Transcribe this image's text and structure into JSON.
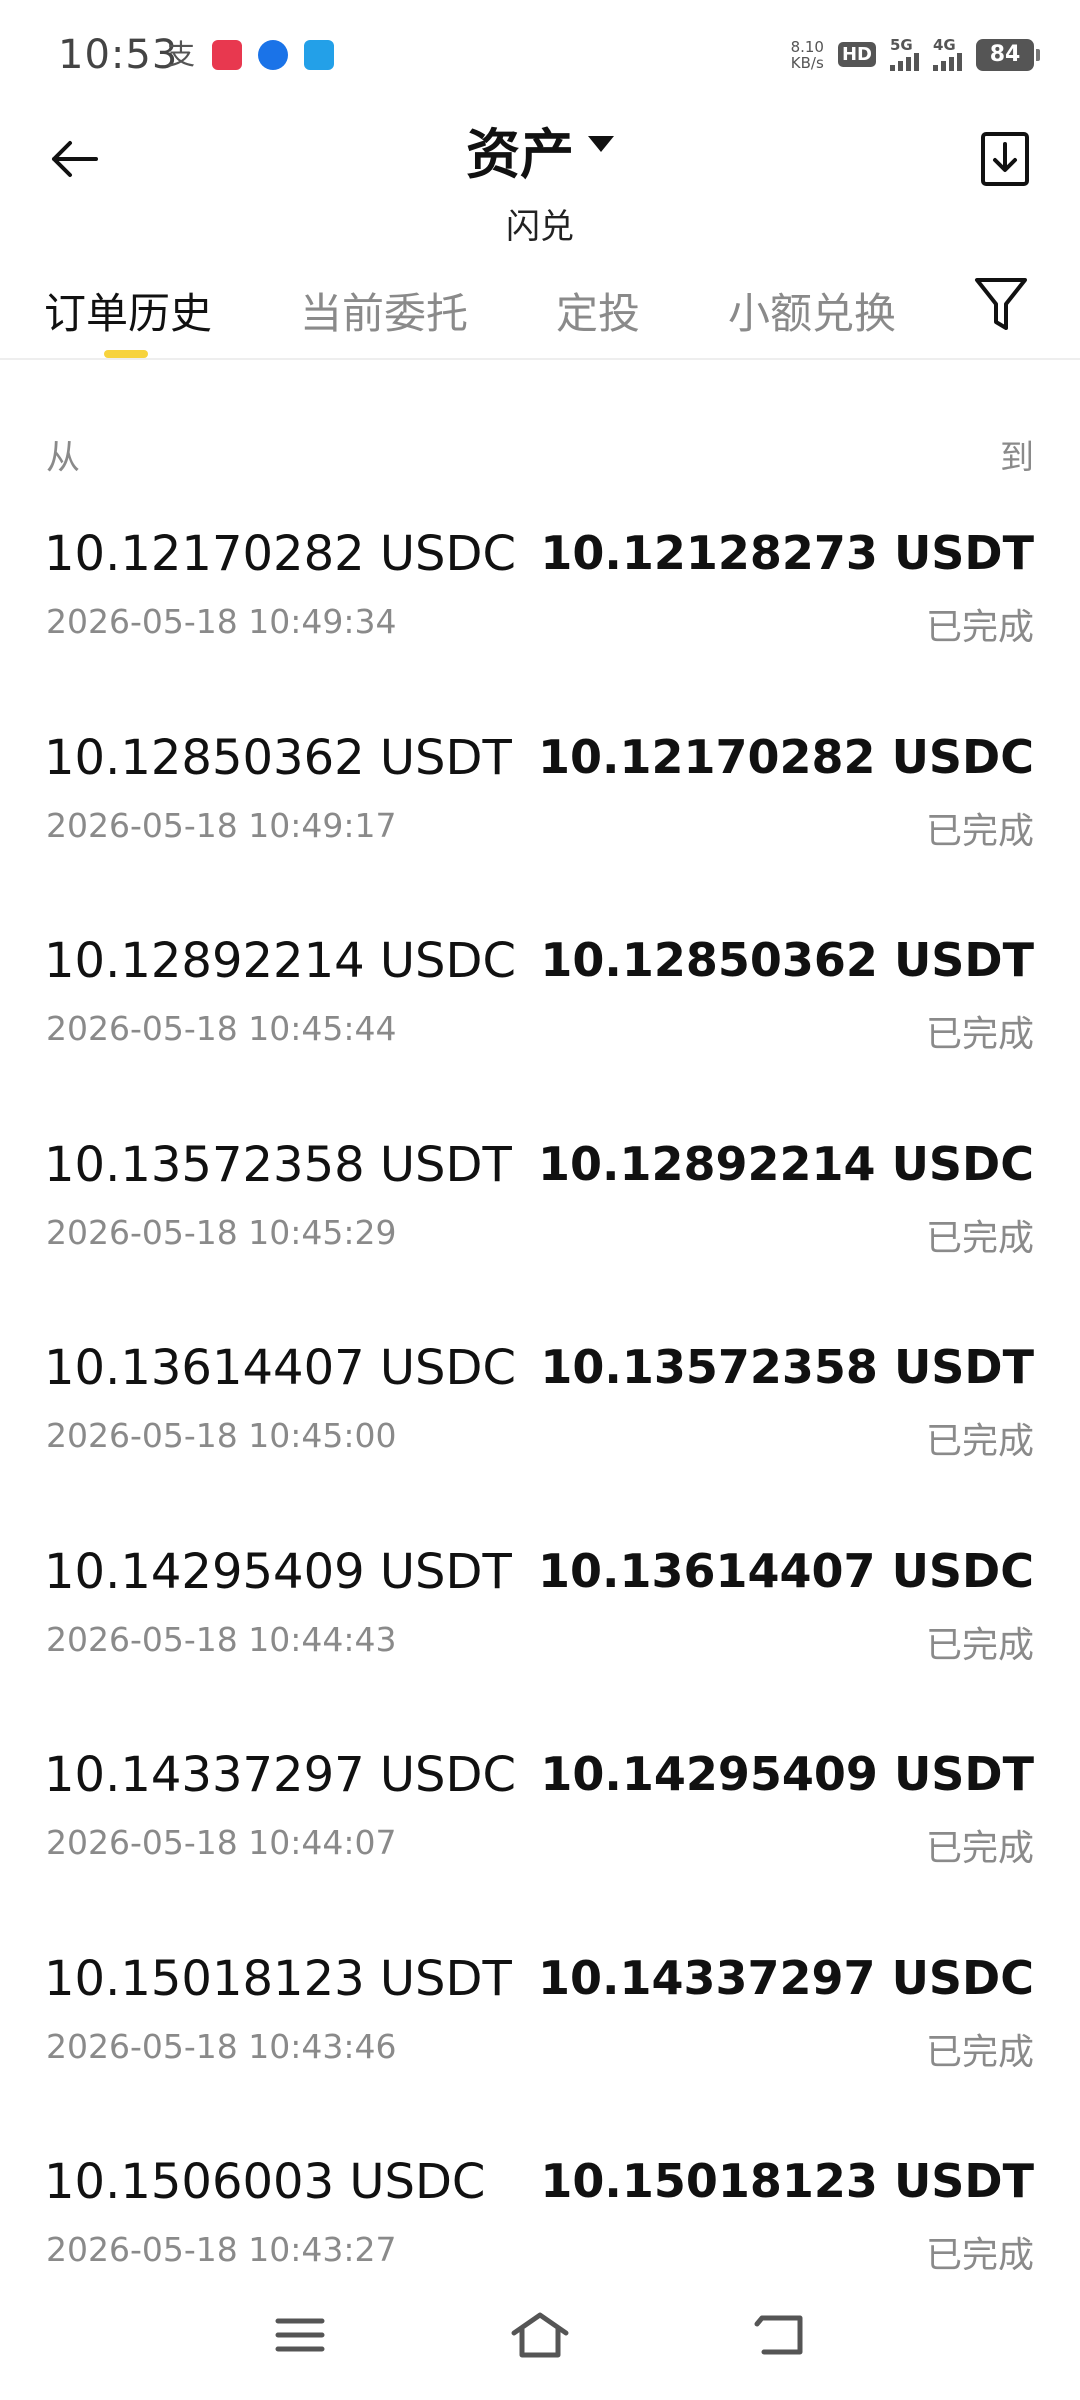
{
  "status_bar": {
    "time": "10:53",
    "net_speed_value": "8.10",
    "net_speed_unit": "KB/s",
    "hd_label": "HD",
    "sim1": "5G",
    "sim2": "4G",
    "battery": "84"
  },
  "header": {
    "title": "资产",
    "subtitle": "闪兑"
  },
  "tabs": [
    {
      "label": "订单历史",
      "active": true
    },
    {
      "label": "当前委托",
      "active": false
    },
    {
      "label": "定投",
      "active": false
    },
    {
      "label": "小额兑换",
      "active": false
    }
  ],
  "columns": {
    "from": "从",
    "to": "到"
  },
  "orders": [
    {
      "from": "10.12170282 USDC",
      "to": "10.12128273 USDT",
      "time": "2026-05-18 10:49:34",
      "status": "已完成"
    },
    {
      "from": "10.12850362 USDT",
      "to": "10.12170282 USDC",
      "time": "2026-05-18 10:49:17",
      "status": "已完成"
    },
    {
      "from": "10.12892214 USDC",
      "to": "10.12850362 USDT",
      "time": "2026-05-18 10:45:44",
      "status": "已完成"
    },
    {
      "from": "10.13572358 USDT",
      "to": "10.12892214 USDC",
      "time": "2026-05-18 10:45:29",
      "status": "已完成"
    },
    {
      "from": "10.13614407 USDC",
      "to": "10.13572358 USDT",
      "time": "2026-05-18 10:45:00",
      "status": "已完成"
    },
    {
      "from": "10.14295409 USDT",
      "to": "10.13614407 USDC",
      "time": "2026-05-18 10:44:43",
      "status": "已完成"
    },
    {
      "from": "10.14337297 USDC",
      "to": "10.14295409 USDT",
      "time": "2026-05-18 10:44:07",
      "status": "已完成"
    },
    {
      "from": "10.15018123 USDT",
      "to": "10.14337297 USDC",
      "time": "2026-05-18 10:43:46",
      "status": "已完成"
    },
    {
      "from": "10.1506003 USDC",
      "to": "10.15018123 USDT",
      "time": "2026-05-18 10:43:27",
      "status": "已完成"
    }
  ],
  "colors": {
    "accent": "#f7d33d",
    "text_primary": "#111111",
    "text_secondary": "#8a8a8a"
  }
}
